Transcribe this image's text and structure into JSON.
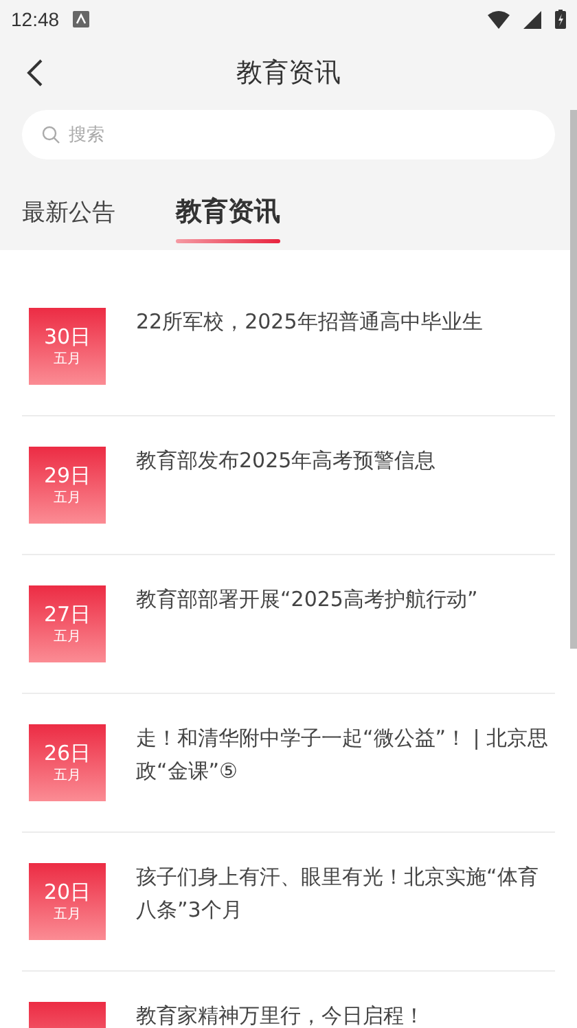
{
  "status_bar": {
    "time": "12:48"
  },
  "header": {
    "title": "教育资讯"
  },
  "search": {
    "placeholder": "搜索"
  },
  "tabs": [
    {
      "label": "最新公告",
      "selected": false
    },
    {
      "label": "教育资讯",
      "selected": true
    }
  ],
  "articles": [
    {
      "day": "30日",
      "month": "五月",
      "title": "22所军校，2025年招普通高中毕业生"
    },
    {
      "day": "29日",
      "month": "五月",
      "title": "教育部发布2025年高考预警信息"
    },
    {
      "day": "27日",
      "month": "五月",
      "title": "教育部部署开展“2025高考护航行动”"
    },
    {
      "day": "26日",
      "month": "五月",
      "title": "走！和清华附中学子一起“微公益”！ | 北京思政“金课”⑤"
    },
    {
      "day": "20日",
      "month": "五月",
      "title": "孩子们身上有汗、眼里有光！北京实施“体育八条”3个月"
    },
    {
      "title": "教育家精神万里行，今日启程！"
    }
  ]
}
